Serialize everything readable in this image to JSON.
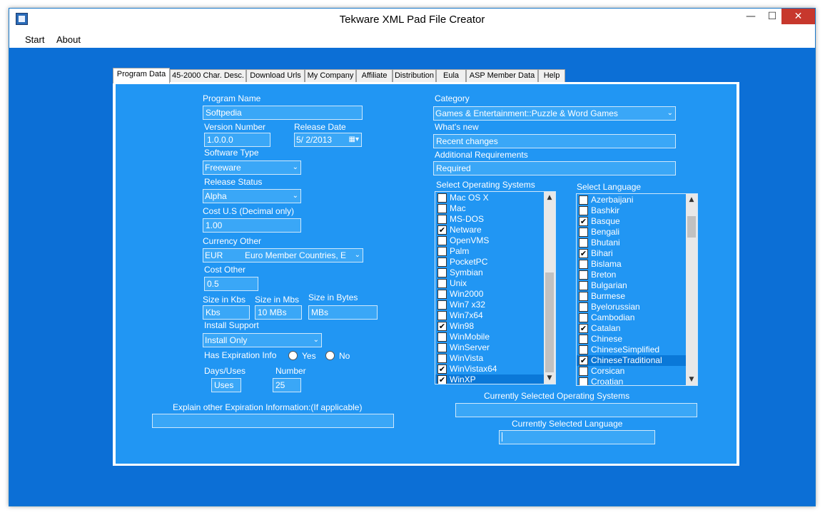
{
  "window": {
    "title": "Tekware XML Pad File Creator",
    "min": "—",
    "max": "☐",
    "close": "✕"
  },
  "menu": {
    "start": "Start",
    "about": "About"
  },
  "tabs": [
    "Program Data",
    "45-2000 Char. Desc.",
    "Download Urls",
    "My Company",
    "Affiliate",
    "Distribution",
    "Eula",
    "ASP Member Data",
    "Help"
  ],
  "form": {
    "program_name_label": "Program Name",
    "program_name": "Softpedia",
    "version_label": "Version Number",
    "version": "1.0.0.0",
    "release_date_label": "Release Date",
    "release_date": "5/  2/2013",
    "software_type_label": "Software Type",
    "software_type": "Freeware",
    "release_status_label": "Release Status",
    "release_status": "Alpha",
    "cost_us_label": "Cost U.S (Decimal only)",
    "cost_us": "1.00",
    "currency_other_label": "Currency Other",
    "currency_code": "EUR",
    "currency_name": "Euro Member Countries, E",
    "cost_other_label": "Cost Other",
    "cost_other": "0.5",
    "size_kbs_label": "Size in Kbs",
    "size_kbs": "Kbs",
    "size_mbs_label": "Size in Mbs",
    "size_mbs": "10 MBs",
    "size_bytes_label": "Size in Bytes",
    "size_bytes": "MBs",
    "install_support_label": "Install Support",
    "install_support": "Install Only",
    "expiration_label": "Has Expiration Info",
    "yes_label": "Yes",
    "no_label": "No",
    "days_uses_label": "Days/Uses",
    "days_uses": "Uses",
    "number_label": "Number",
    "number": "25",
    "explain_label": "Explain other Expiration Information:(If applicable)",
    "explain": "",
    "category_label": "Category",
    "category": "Games & Entertainment::Puzzle & Word Games",
    "whats_new_label": "What's new",
    "whats_new": "Recent changes",
    "additional_req_label": "Additional Requirements",
    "additional_req": "Required",
    "os_label": "Select Operating Systems",
    "lang_label": "Select Language",
    "current_os_label": "Currently Selected Operating Systems",
    "current_os": "",
    "current_lang_label": "Currently Selected Language",
    "current_lang": ""
  },
  "os_list": [
    {
      "label": "Mac OS X",
      "checked": false
    },
    {
      "label": "Mac",
      "checked": false
    },
    {
      "label": "MS-DOS",
      "checked": false
    },
    {
      "label": "Netware",
      "checked": true
    },
    {
      "label": "OpenVMS",
      "checked": false
    },
    {
      "label": "Palm",
      "checked": false
    },
    {
      "label": "PocketPC",
      "checked": false
    },
    {
      "label": "Symbian",
      "checked": false
    },
    {
      "label": "Unix",
      "checked": false
    },
    {
      "label": "Win2000",
      "checked": false
    },
    {
      "label": "Win7 x32",
      "checked": false
    },
    {
      "label": "Win7x64",
      "checked": false
    },
    {
      "label": "Win98",
      "checked": true
    },
    {
      "label": "WinMobile",
      "checked": false
    },
    {
      "label": "WinServer",
      "checked": false
    },
    {
      "label": "WinVista",
      "checked": false
    },
    {
      "label": "WinVistax64",
      "checked": true
    },
    {
      "label": "WinXP",
      "checked": true,
      "selected": true
    }
  ],
  "lang_list": [
    {
      "label": "Azerbaijani",
      "checked": false
    },
    {
      "label": "Bashkir",
      "checked": false
    },
    {
      "label": "Basque",
      "checked": true
    },
    {
      "label": "Bengali",
      "checked": false
    },
    {
      "label": "Bhutani",
      "checked": false
    },
    {
      "label": "Bihari",
      "checked": true
    },
    {
      "label": "Bislama",
      "checked": false
    },
    {
      "label": "Breton",
      "checked": false
    },
    {
      "label": "Bulgarian",
      "checked": false
    },
    {
      "label": "Burmese",
      "checked": false
    },
    {
      "label": "Byelorussian",
      "checked": false
    },
    {
      "label": "Cambodian",
      "checked": false
    },
    {
      "label": "Catalan",
      "checked": true
    },
    {
      "label": "Chinese",
      "checked": false
    },
    {
      "label": "ChineseSimplified",
      "checked": false
    },
    {
      "label": "ChineseTraditional",
      "checked": true,
      "selected": true
    },
    {
      "label": "Corsican",
      "checked": false
    },
    {
      "label": "Croatian",
      "checked": false
    }
  ],
  "icons": {
    "dropdown": "chevron-down-icon",
    "calendar": "calendar-icon",
    "check": "✔",
    "scroll_up": "▲",
    "scroll_down": "▼",
    "chev": "⌄"
  },
  "colors": {
    "client_bg": "#0c6fd6",
    "panel_bg": "#2196f3",
    "field_bg": "#3aa7f7",
    "selection": "#0a78d8"
  }
}
